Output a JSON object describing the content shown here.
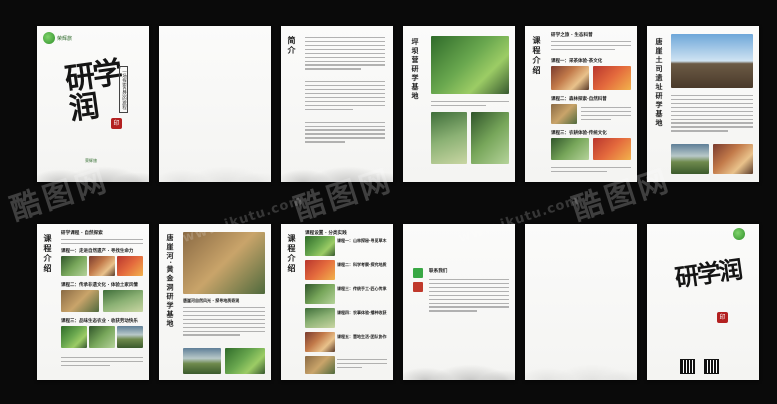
{
  "brand": {
    "logo_text": "荣辉旅",
    "accent": "#2f8f2a",
    "seal_color": "#b32020",
    "icons": [
      "leaf-logo",
      "seal-stamp",
      "qr-code"
    ]
  },
  "cover": {
    "title": "研学润",
    "vertical_tag": "一场探索自然的旅程",
    "seal_text": "印",
    "signature": "荣辉旅"
  },
  "pages": {
    "intro": {
      "label": "简介"
    },
    "camp": {
      "label": "坪坝营研学基地"
    },
    "course": {
      "label": "课程介绍",
      "top_heading": "研学之旅 · 生态科普"
    },
    "site": {
      "label": "唐崖土司遗址研学基地"
    },
    "river": {
      "label": "唐崖河·黄金洞研学基地",
      "caption": "唐崖河自然风光 · 探寻地质奇观"
    },
    "courses_row2": {
      "label": "课程介绍",
      "top_heading": "研学课程 · 自然探索"
    },
    "courses_col3": {
      "label": "课程介绍",
      "top_heading": "课程设置 · 分类实践"
    },
    "contact": {
      "label": "联系我们"
    },
    "back_cover": {
      "title": "研学润",
      "seal_text": "印"
    }
  },
  "course_items": {
    "c1": "课程一：采茶体验·茶文化",
    "c2": "课程二：森林探索·自然科普",
    "c3": "课程三：农耕体验·传统文化",
    "r1": "课程一：走进自然遗产 · 寻找生命力",
    "r2": "课程二：传承非遗文化 · 体验土家风情",
    "r3": "课程三：品味生态农业 · 收获劳动快乐",
    "k1": "课程一：山林探秘·寻觅草木",
    "k2": "课程二：科学考察·探究地质",
    "k3": "课程三：传统手工·匠心传承",
    "k4": "课程四：农事体验·播种收获",
    "k5": "课程五：营地生活·团队协作"
  },
  "watermarks": {
    "brand": "酷图网",
    "url": "www.ikutu.com"
  }
}
